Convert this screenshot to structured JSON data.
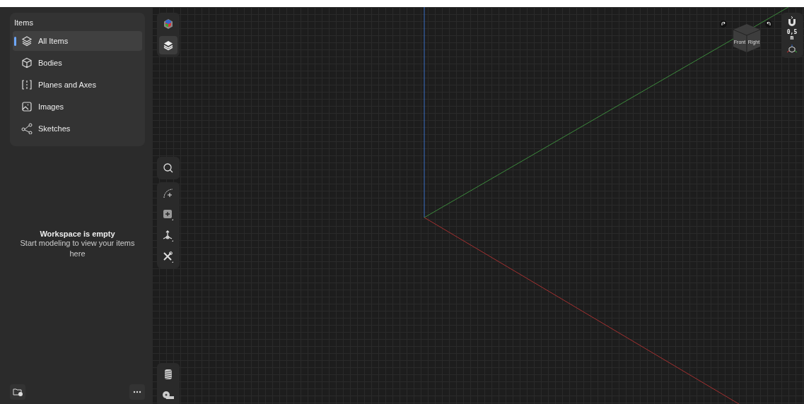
{
  "items_panel": {
    "title": "Items",
    "items": [
      {
        "label": "All Items",
        "selected": true
      },
      {
        "label": "Bodies",
        "selected": false
      },
      {
        "label": "Planes and Axes",
        "selected": false
      },
      {
        "label": "Images",
        "selected": false
      },
      {
        "label": "Sketches",
        "selected": false
      }
    ]
  },
  "empty_state": {
    "title": "Workspace is empty",
    "message": "Start modeling to view your items here"
  },
  "view_cube": {
    "faces": [
      "Front",
      "Right"
    ]
  },
  "snap": {
    "value": "0,5",
    "unit": "m"
  }
}
